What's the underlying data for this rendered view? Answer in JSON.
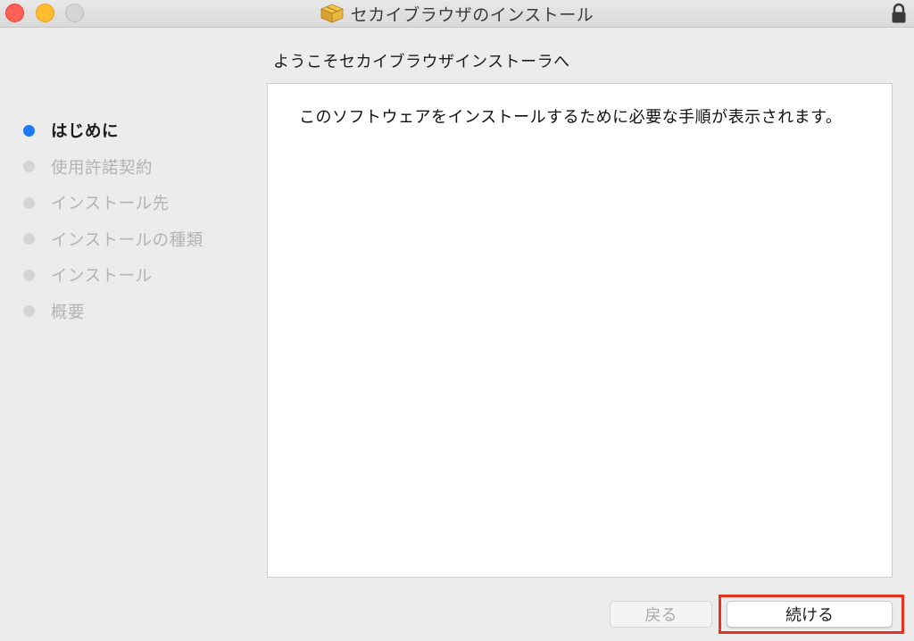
{
  "window": {
    "title": "セカイブラウザのインストール",
    "icon": "package-icon",
    "lock_icon": "lock-icon"
  },
  "heading": "ようこそセカイブラウザインストーラへ",
  "steps": [
    {
      "label": "はじめに",
      "active": true
    },
    {
      "label": "使用許諾契約",
      "active": false
    },
    {
      "label": "インストール先",
      "active": false
    },
    {
      "label": "インストールの種類",
      "active": false
    },
    {
      "label": "インストール",
      "active": false
    },
    {
      "label": "概要",
      "active": false
    }
  ],
  "content": {
    "text": "このソフトウェアをインストールするために必要な手順が表示されます。"
  },
  "buttons": {
    "back_label": "戻る",
    "continue_label": "続ける"
  },
  "colors": {
    "active_step": "#1f7af5",
    "highlight": "#e8321e",
    "close": "#fe5f57",
    "minimize": "#febc2e"
  }
}
